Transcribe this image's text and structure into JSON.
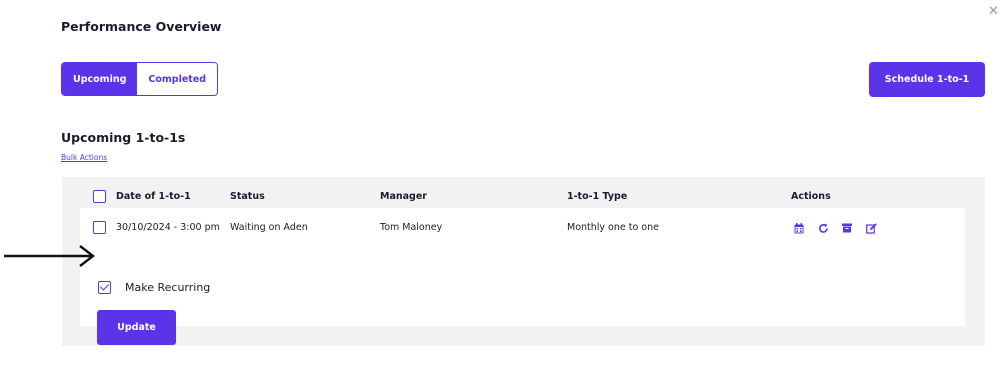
{
  "close_icon": "close-icon",
  "page_title": "Performance Overview",
  "tabs": [
    {
      "label": "Upcoming",
      "active": true
    },
    {
      "label": "Completed",
      "active": false
    }
  ],
  "schedule_button": "Schedule 1-to-1",
  "section_title": "Upcoming 1-to-1s",
  "bulk_actions": "Bulk Actions",
  "table": {
    "headers": [
      "Date of 1-to-1",
      "Status",
      "Manager",
      "1-to-1 Type",
      "Actions"
    ],
    "rows": [
      {
        "date": "30/10/2024 - 3:00 pm",
        "status": "Waiting on Aden",
        "manager": "Tom Maloney",
        "type": "Monthly one to one",
        "actions": [
          "calendar-icon",
          "reschedule-icon",
          "archive-icon",
          "edit-icon"
        ]
      }
    ]
  },
  "recurring": {
    "label": "Make Recurring",
    "checked": true
  },
  "update_button": "Update",
  "colors": {
    "accent": "#5b34ea",
    "status_waiting": "#f07a2c",
    "panel_bg": "#f2f2f3"
  }
}
